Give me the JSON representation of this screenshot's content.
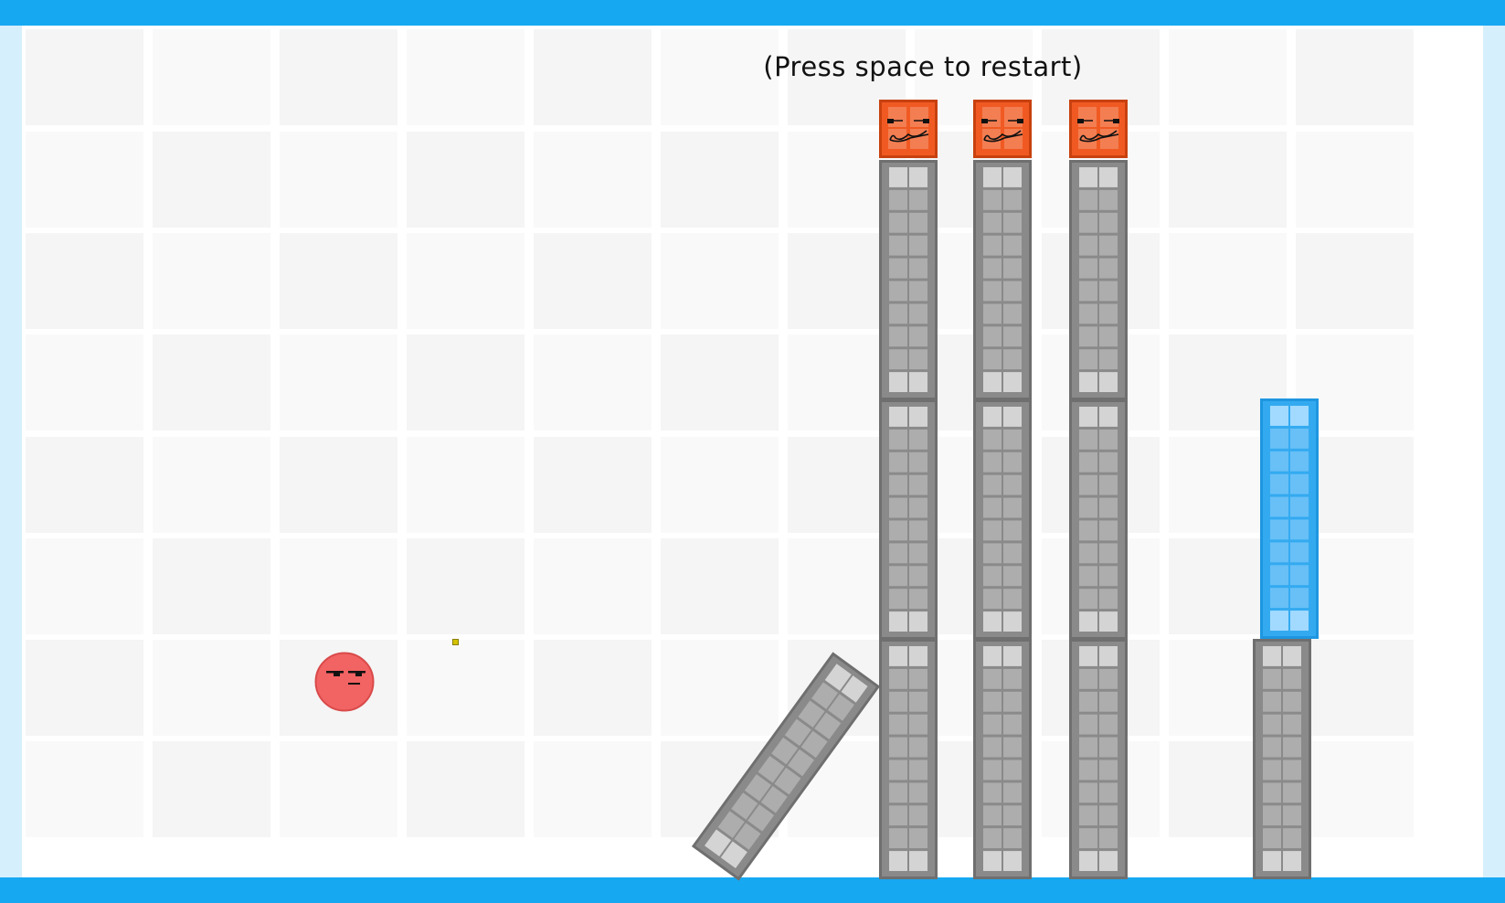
{
  "hud": {
    "hint": "(Press space to restart)"
  },
  "colors": {
    "frame": "#17a8f2",
    "frame_side": "#d6effc",
    "field_bg": "#ffffff",
    "tile_a": "#f5f5f5",
    "tile_b": "#f9f9f9",
    "gray_block": "#8a8a8a",
    "gray_block_border": "#6f6f6f",
    "blue_block": "#33aaf0",
    "orange_block": "#f05a22",
    "ball": "#f26363"
  },
  "pieces": {
    "ball": {
      "kind": "red-ball",
      "icon": "smug-face-icon"
    },
    "target_face": {
      "kind": "orange-face-block",
      "icon": "mustache-face-icon"
    },
    "special": {
      "kind": "blue-block"
    },
    "grain": {
      "kind": "yellow-speck"
    }
  }
}
